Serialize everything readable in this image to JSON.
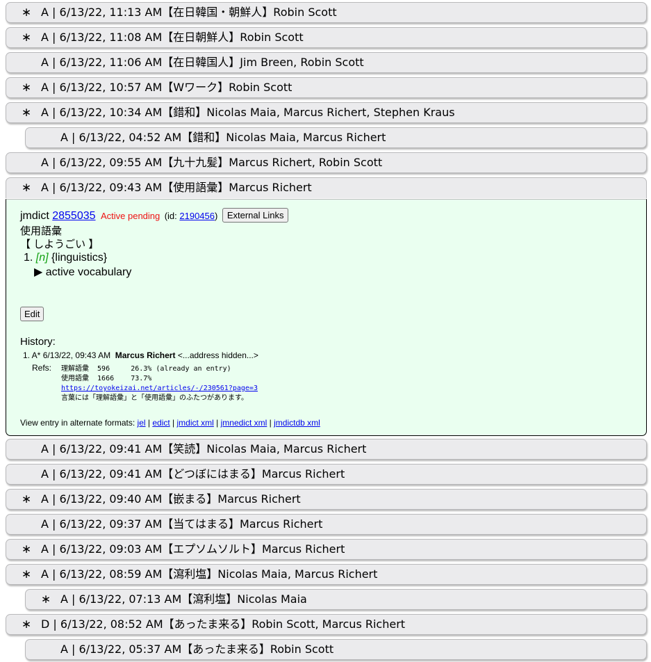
{
  "rows_before": [
    {
      "star": "∗",
      "summary": "A | 6/13/22, 11:13 AM【在日韓国・朝鮮人】Robin Scott"
    },
    {
      "star": "∗",
      "summary": "A | 6/13/22, 11:08 AM【在日朝鮮人】Robin Scott"
    },
    {
      "star": "",
      "summary": "A | 6/13/22, 11:06 AM【在日韓国人】Jim Breen, Robin Scott"
    },
    {
      "star": "∗",
      "summary": "A | 6/13/22, 10:57 AM【Wワーク】Robin Scott"
    },
    {
      "star": "∗",
      "summary": "A | 6/13/22, 10:34 AM【錯和】Nicolas Maia, Marcus Richert, Stephen Kraus"
    },
    {
      "star": "",
      "summary": "A | 6/13/22, 04:52 AM【錯和】Nicolas Maia, Marcus Richert"
    },
    {
      "star": "",
      "summary": "A | 6/13/22, 09:55 AM【九十九髪】Marcus Richert, Robin Scott"
    },
    {
      "star": "∗",
      "summary": "A | 6/13/22, 09:43 AM【使用語彙】Marcus Richert"
    }
  ],
  "entry": {
    "corpus": "jmdict",
    "seq": "2855035",
    "status": "Active pending",
    "id_prefix": "(id: ",
    "id": "2190456",
    "id_suffix": ")",
    "external_links": "External Links",
    "kanji": "使用語彙",
    "reading": "【 しようごい 】",
    "sense_num": "1.",
    "pos": "[n]",
    "field": "{linguistics}",
    "gloss": "▶ active vocabulary",
    "edit": "Edit",
    "history_label": "History:",
    "history": {
      "prefix": "1. A* 6/13/22, 09:43 AM",
      "name": "Marcus Richert",
      "email": "<...address hidden...>",
      "refs_label": "Refs:",
      "ref1": "理解語彙  596     26.3% (already an entry)",
      "ref2": "使用語彙  1666    73.7%",
      "ref_link": "https://toyokeizai.net/articles/-/230561?page=3",
      "ref4": "言葉には「理解語彙」と「使用語彙」のふたつがあります。"
    },
    "formats_label": "View entry in alternate formats:",
    "formats": [
      "jel",
      "edict",
      "jmdict xml",
      "jmnedict xml",
      "jmdictdb xml"
    ],
    "formats_sep": " | "
  },
  "rows_after": [
    {
      "star": "",
      "summary": "A | 6/13/22, 09:41 AM【笑読】Nicolas Maia, Marcus Richert"
    },
    {
      "star": "",
      "summary": "A | 6/13/22, 09:41 AM【どつぼにはまる】Marcus Richert"
    },
    {
      "star": "∗",
      "summary": "A | 6/13/22, 09:40 AM【嵌まる】Marcus Richert"
    },
    {
      "star": "",
      "summary": "A | 6/13/22, 09:37 AM【当てはまる】Marcus Richert"
    },
    {
      "star": "∗",
      "summary": "A | 6/13/22, 09:03 AM【エプソムソルト】Marcus Richert"
    },
    {
      "star": "∗",
      "summary": "A | 6/13/22, 08:59 AM【瀉利塩】Nicolas Maia, Marcus Richert"
    },
    {
      "star": "∗",
      "summary": "A | 6/13/22, 07:13 AM【瀉利塩】Nicolas Maia"
    },
    {
      "star": "∗",
      "summary": "D | 6/13/22, 08:52 AM【あったま来る】Robin Scott, Marcus Richert"
    },
    {
      "star": "",
      "summary": "A | 6/13/22, 05:37 AM【あったま来る】Robin Scott"
    }
  ]
}
